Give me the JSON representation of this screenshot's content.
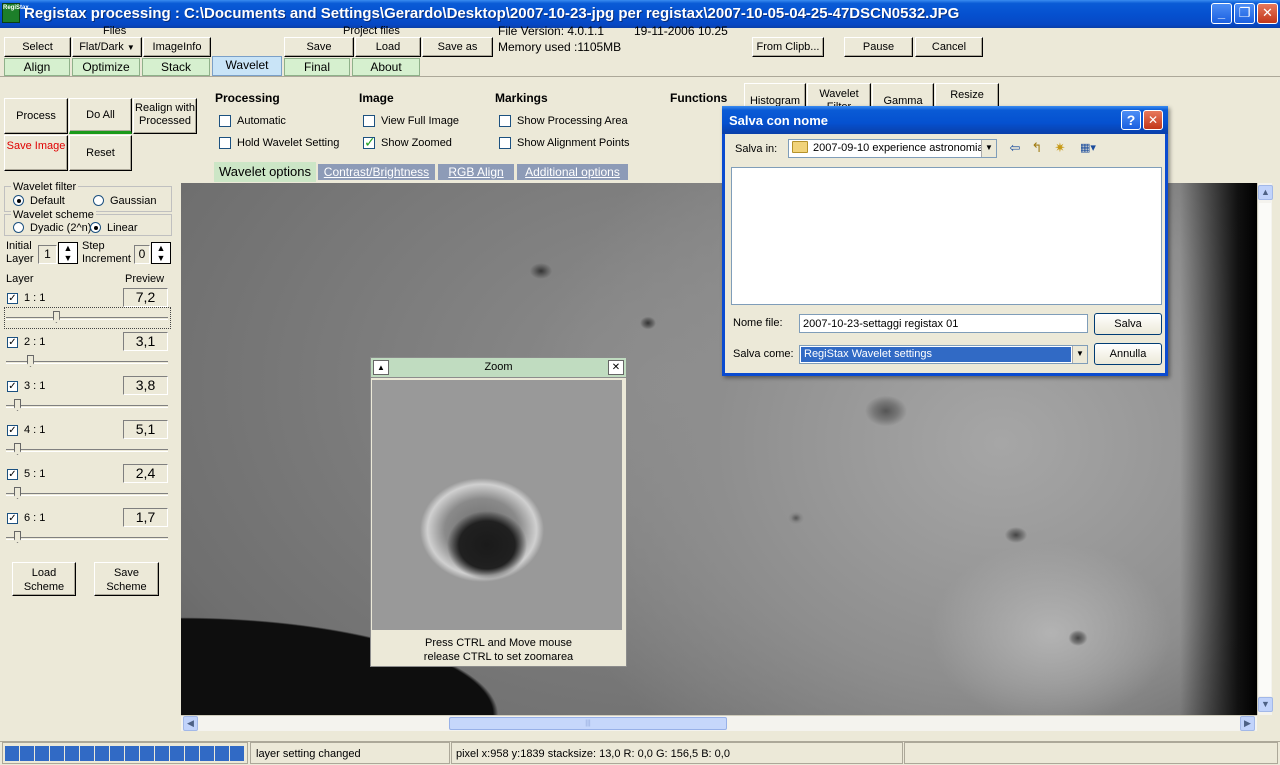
{
  "window": {
    "title": "Registax processing : C:\\Documents and Settings\\Gerardo\\Desktop\\2007-10-23-jpg per registax\\2007-10-05-04-25-47DSCN0532.JPG",
    "app_icon_text": "RegiStax",
    "minimize_glyph": "_",
    "maximize_glyph": "❐",
    "close_glyph": "✕"
  },
  "toolbar": {
    "select": "Select",
    "files_label": "Files",
    "flat_dark": "Flat/Dark",
    "flat_dark_arrow": "▼",
    "imageinfo": "ImageInfo",
    "project_files_label": "Project files",
    "save": "Save",
    "load": "Load",
    "save_as": "Save as",
    "file_version": "File Version: 4.0.1.1",
    "file_date": "19-11-2006 10.25",
    "memory": "Memory used :1105MB",
    "from_clipboard": "From Clipb...",
    "pause": "Pause",
    "cancel": "Cancel"
  },
  "tabs": [
    {
      "label": "Align"
    },
    {
      "label": "Optimize"
    },
    {
      "label": "Stack"
    },
    {
      "label": "Wavelet"
    },
    {
      "label": "Final"
    },
    {
      "label": "About"
    }
  ],
  "actions": {
    "process": "Process",
    "do_all": "Do All",
    "realign": "Realign with Processed",
    "save_image": "Save Image",
    "reset": "Reset"
  },
  "options": {
    "processing_head": "Processing",
    "automatic": "Automatic",
    "hold_wavelet": "Hold Wavelet Setting",
    "image_head": "Image",
    "view_full": "View Full Image",
    "show_zoomed": "Show Zoomed",
    "markings_head": "Markings",
    "show_processing_area": "Show Processing Area",
    "show_alignment_points": "Show Alignment Points",
    "functions_head": "Functions",
    "histogram": "Histogram",
    "wavelet_filter": "Wavelet Filter",
    "gamma": "Gamma",
    "resize": "Resize",
    "checkmark": "✓"
  },
  "subtabs": [
    {
      "label": "Wavelet options"
    },
    {
      "label": "Contrast/Brightness"
    },
    {
      "label": "RGB Align"
    },
    {
      "label": "Additional options"
    }
  ],
  "wavelet_panel": {
    "filter_label": "Wavelet filter",
    "default_label": "Default",
    "gaussian_label": "Gaussian",
    "scheme_label": "Wavelet scheme",
    "dyadic_label": "Dyadic (2^n)",
    "linear_label": "Linear",
    "initial_layer_label": "Initial Layer",
    "initial_layer_value": "1",
    "step_label": "Step Increment",
    "step_value": "0",
    "layer_header": "Layer",
    "preview_header": "Preview",
    "load_scheme": "Load Scheme",
    "save_scheme": "Save Scheme",
    "checkmark": "✓",
    "layers": [
      {
        "label": "1 : 1",
        "value": "7,2",
        "level": 0.03
      },
      {
        "label": "2 : 1",
        "value": "3,1",
        "level": 0.01
      },
      {
        "label": "3 : 1",
        "value": "3,8",
        "level": 0.0
      },
      {
        "label": "4 : 1",
        "value": "5,1",
        "level": 0.0
      },
      {
        "label": "5 : 1",
        "value": "2,4",
        "level": 0.0
      },
      {
        "label": "6 : 1",
        "value": "1,7",
        "level": 0.0
      }
    ]
  },
  "zoom_window": {
    "title": "Zoom",
    "up_glyph": "▲",
    "close_glyph": "✕",
    "hint_line1": "Press CTRL and Move mouse",
    "hint_line2": "release CTRL to set zoomarea"
  },
  "save_dialog": {
    "title": "Salva con nome",
    "help_glyph": "?",
    "close_glyph": "✕",
    "save_in_label": "Salva in:",
    "folder": "2007-09-10 experience astronomia",
    "filename_label": "Nome file:",
    "filename_value": "2007-10-23-settaggi registax 01",
    "save_as_label": "Salva come:",
    "save_as_type": "RegiStax Wavelet settings",
    "save_button": "Salva",
    "cancel_button": "Annulla",
    "back_icon": "⇦",
    "up_icon": "↰",
    "new_folder_icon": "✷",
    "view_icon": "▦▾",
    "dropdown_glyph": "▼"
  },
  "scroll": {
    "up": "▲",
    "down": "▼",
    "left": "◀",
    "right": "▶",
    "grip": "|||"
  },
  "status": {
    "progress_cells": 16,
    "message": "layer setting changed",
    "pixel_info": "pixel x:958 y:1839 stacksize: 13,0 R: 0,0 G: 156,5 B: 0,0"
  }
}
